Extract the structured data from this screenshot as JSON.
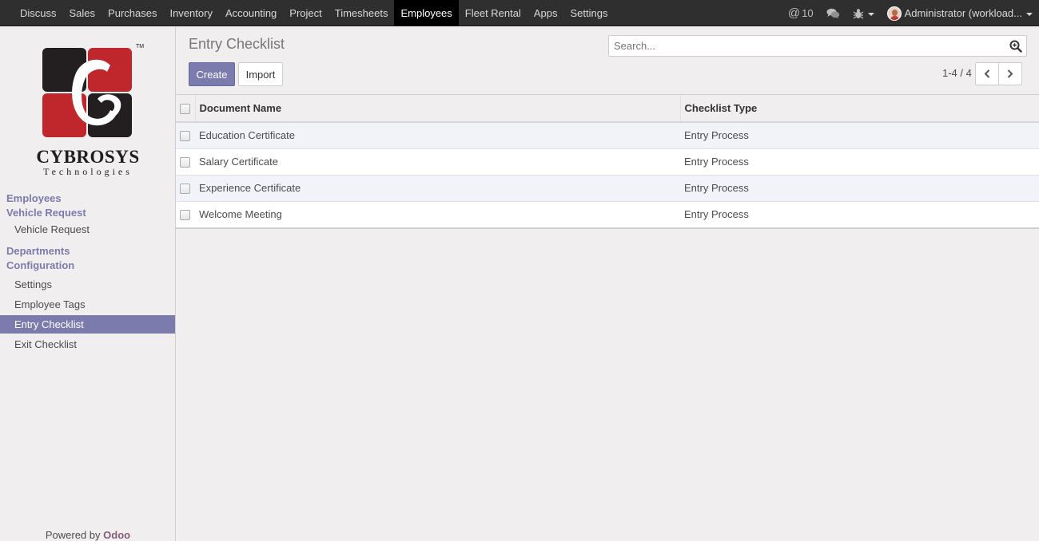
{
  "topbar": {
    "menu": [
      {
        "label": "Discuss"
      },
      {
        "label": "Sales"
      },
      {
        "label": "Purchases"
      },
      {
        "label": "Inventory"
      },
      {
        "label": "Accounting"
      },
      {
        "label": "Project"
      },
      {
        "label": "Timesheets"
      },
      {
        "label": "Employees"
      },
      {
        "label": "Fleet Rental"
      },
      {
        "label": "Apps"
      },
      {
        "label": "Settings"
      }
    ],
    "active_menu": "Employees",
    "mentions_count": "10",
    "user_name": "Administrator (workload...",
    "icons": [
      "at-icon",
      "chat-icon",
      "bug-icon",
      "avatar"
    ]
  },
  "sidebar": {
    "logo_text": "CYBROSYS",
    "logo_sub": "Technologies",
    "logo_mark": "TM",
    "headings": [
      "Employees",
      "Vehicle Request",
      "Departments",
      "Configuration"
    ],
    "vehicle_links": [
      "Vehicle Request"
    ],
    "config_links": [
      "Settings",
      "Employee Tags",
      "Entry Checklist",
      "Exit Checklist"
    ],
    "active_link": "Entry Checklist",
    "powered_by": "Powered by",
    "powered_brand": "Odoo"
  },
  "control_panel": {
    "title": "Entry Checklist",
    "search_placeholder": "Search...",
    "create_label": "Create",
    "import_label": "Import",
    "pager": "1-4 / 4"
  },
  "table": {
    "columns": [
      "Document Name",
      "Checklist Type"
    ],
    "rows": [
      {
        "name": "Education Certificate",
        "type": "Entry Process"
      },
      {
        "name": "Salary Certificate",
        "type": "Entry Process"
      },
      {
        "name": "Experience Certificate",
        "type": "Entry Process"
      },
      {
        "name": "Welcome Meeting",
        "type": "Entry Process"
      }
    ]
  },
  "colors": {
    "accent": "#7c7bad",
    "topbar": "#2f2f2f",
    "brand_red": "#c0272d",
    "odoo": "#875a7b"
  }
}
